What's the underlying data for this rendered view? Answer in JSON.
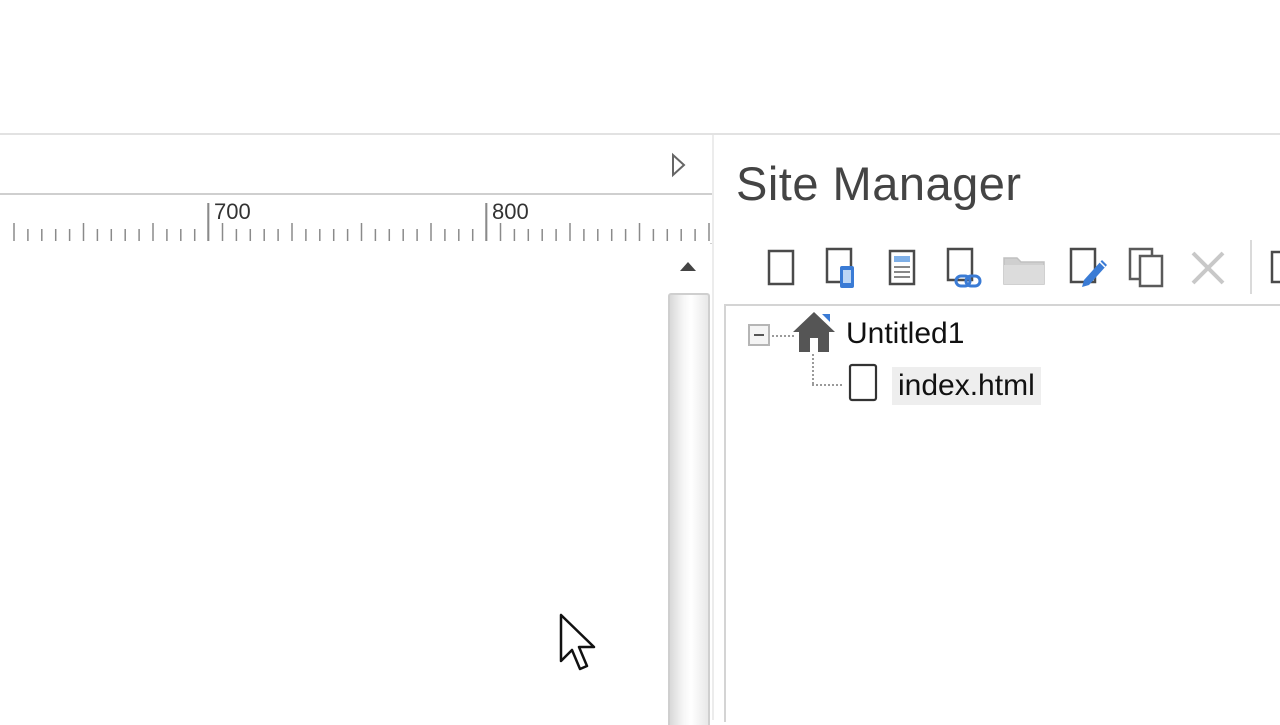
{
  "ruler": {
    "labels": [
      "700",
      "800"
    ]
  },
  "site_manager": {
    "title": "Site Manager",
    "toolbar": [
      {
        "name": "new-page-icon"
      },
      {
        "name": "new-mobile-page-icon"
      },
      {
        "name": "new-template-icon"
      },
      {
        "name": "add-link-icon"
      },
      {
        "name": "new-folder-icon"
      },
      {
        "name": "edit-page-icon"
      },
      {
        "name": "duplicate-page-icon"
      },
      {
        "name": "delete-icon"
      },
      {
        "name": "more-icon"
      }
    ],
    "tree": {
      "root_label": "Untitled1",
      "children": [
        {
          "label": "index.html",
          "selected": true
        }
      ]
    }
  },
  "colors": {
    "icon_gray": "#5a5a5a",
    "icon_blue": "#3a7bd5",
    "disabled_gray": "#c8c8c8"
  }
}
